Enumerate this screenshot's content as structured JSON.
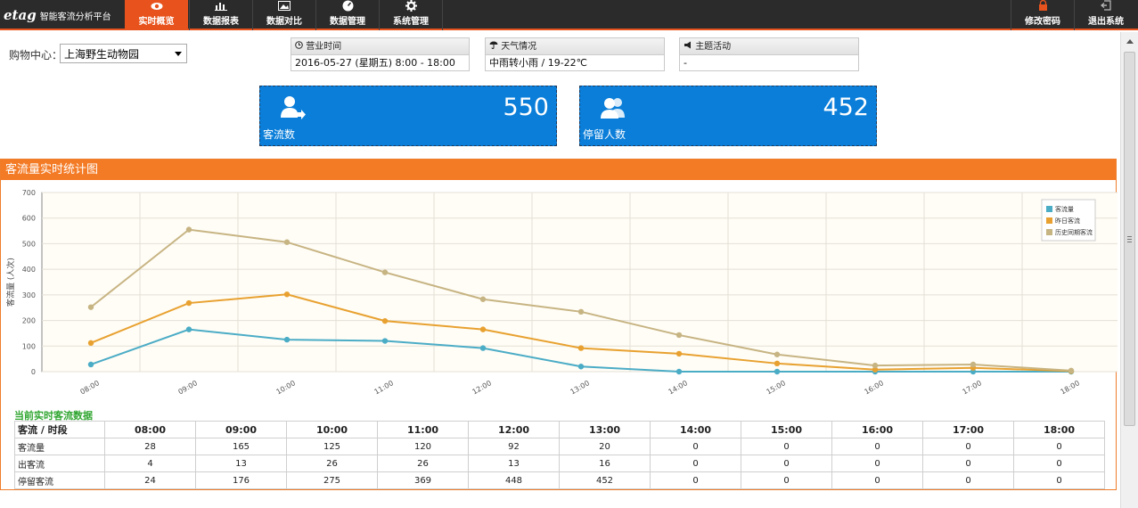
{
  "brand": {
    "logo": "etag",
    "name": "智能客流分析平台"
  },
  "nav": {
    "items": [
      {
        "label": "实时概览",
        "icon": "eye-icon",
        "active": true
      },
      {
        "label": "数据报表",
        "icon": "bar-chart-icon",
        "active": false
      },
      {
        "label": "数据对比",
        "icon": "image-icon",
        "active": false
      },
      {
        "label": "数据管理",
        "icon": "dashboard-icon",
        "active": false
      },
      {
        "label": "系统管理",
        "icon": "gear-icon",
        "active": false
      }
    ],
    "right": [
      {
        "label": "修改密码",
        "icon": "lock-icon"
      },
      {
        "label": "退出系统",
        "icon": "logout-icon"
      }
    ]
  },
  "filters": {
    "mall_label": "购物中心：",
    "mall_value": "上海野生动物园"
  },
  "info": {
    "hours": {
      "title": "营业时间",
      "value": "2016-05-27 (星期五)  8:00 - 18:00"
    },
    "weather": {
      "title": "天气情况",
      "value": "中雨转小雨 / 19-22℃"
    },
    "event": {
      "title": "主题活动",
      "value": "-"
    }
  },
  "tiles": {
    "traffic": {
      "value": "550",
      "label": "客流数"
    },
    "staying": {
      "value": "452",
      "label": "停留人数"
    }
  },
  "panel": {
    "title": "客流量实时统计图"
  },
  "chart_data": {
    "type": "line",
    "categories": [
      "08:00",
      "09:00",
      "10:00",
      "11:00",
      "12:00",
      "13:00",
      "14:00",
      "15:00",
      "16:00",
      "17:00",
      "18:00"
    ],
    "ylabel": "客流量 (人次)",
    "ylim": [
      0,
      700
    ],
    "yticks": [
      0,
      100,
      200,
      300,
      400,
      500,
      600,
      700
    ],
    "grid": true,
    "legend": "top-right",
    "series": [
      {
        "name": "客流量",
        "color": "#4bacc6",
        "values": [
          28,
          165,
          125,
          120,
          92,
          20,
          0,
          0,
          0,
          0,
          0
        ]
      },
      {
        "name": "昨日客流",
        "color": "#e8a130",
        "values": [
          112,
          268,
          302,
          198,
          165,
          92,
          70,
          32,
          8,
          15,
          2
        ]
      },
      {
        "name": "历史同期客流",
        "color": "#c7b483",
        "values": [
          252,
          555,
          506,
          388,
          283,
          234,
          143,
          67,
          24,
          28,
          4
        ]
      }
    ]
  },
  "realtime": {
    "title": "当前实时客流数据",
    "corner": "客流 / 时段",
    "times": [
      "08:00",
      "09:00",
      "10:00",
      "11:00",
      "12:00",
      "13:00",
      "14:00",
      "15:00",
      "16:00",
      "17:00",
      "18:00"
    ],
    "rows": [
      {
        "label": "客流量",
        "values": [
          "28",
          "165",
          "125",
          "120",
          "92",
          "20",
          "0",
          "0",
          "0",
          "0",
          "0"
        ]
      },
      {
        "label": "出客流",
        "values": [
          "4",
          "13",
          "26",
          "26",
          "13",
          "16",
          "0",
          "0",
          "0",
          "0",
          "0"
        ]
      },
      {
        "label": "停留客流",
        "values": [
          "24",
          "176",
          "275",
          "369",
          "448",
          "452",
          "0",
          "0",
          "0",
          "0",
          "0"
        ]
      }
    ]
  }
}
